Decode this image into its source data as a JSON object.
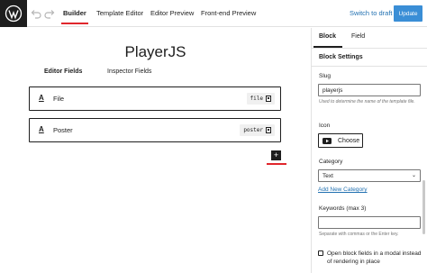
{
  "topbar": {
    "tabs": [
      "Builder",
      "Template Editor",
      "Editor Preview",
      "Front-end Preview"
    ],
    "switch_label": "Switch to draft",
    "update_label": "Update"
  },
  "canvas": {
    "title": "PlayerJS",
    "subtabs": [
      "Editor Fields",
      "Inspector Fields"
    ],
    "fields": [
      {
        "icon": "A",
        "name": "File",
        "slug": "file"
      },
      {
        "icon": "A",
        "name": "Poster",
        "slug": "poster"
      }
    ],
    "add_label": "+"
  },
  "sidebar": {
    "tabs": [
      "Block",
      "Field"
    ],
    "section_title": "Block Settings",
    "slug_label": "Slug",
    "slug_value": "playerjs",
    "slug_help": "Used to determine the name of the template file.",
    "icon_label": "Icon",
    "choose_label": "Choose",
    "category_label": "Category",
    "category_value": "Text",
    "add_category_label": "Add New Category",
    "keywords_label": "Keywords (max 3)",
    "keywords_value": "",
    "keywords_help": "Separate with commas or the Enter key.",
    "modal_label": "Open block fields in a modal instead of rendering in place"
  },
  "colors": {
    "accent": "#e0262c",
    "link": "#2271b1",
    "update_bg": "#3a8ed6",
    "dark": "#1e1e1e"
  }
}
